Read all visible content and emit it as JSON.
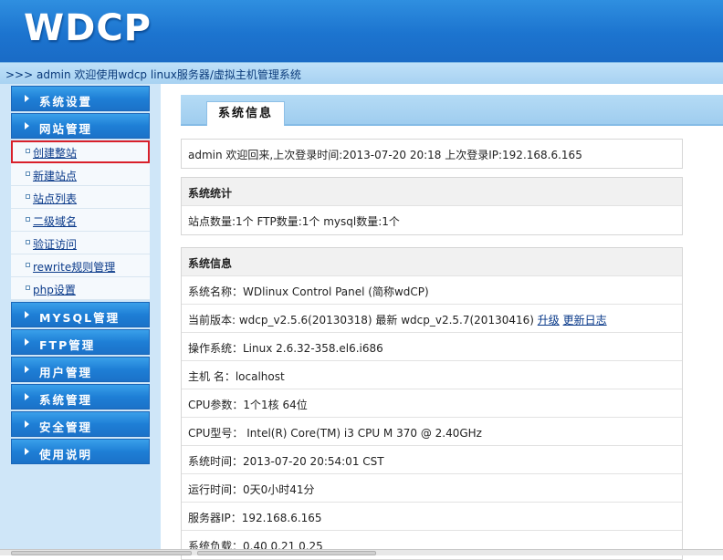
{
  "header": {
    "logo": "WDCP",
    "welcome": ">>> admin 欢迎使用wdcp linux服务器/虚拟主机管理系统"
  },
  "sidebar": {
    "sections": [
      {
        "label": "系统设置"
      },
      {
        "label": "网站管理"
      },
      {
        "label": "MYSQL管理"
      },
      {
        "label": "FTP管理"
      },
      {
        "label": "用户管理"
      },
      {
        "label": "系统管理"
      },
      {
        "label": "安全管理"
      },
      {
        "label": "使用说明"
      }
    ],
    "site_items": [
      {
        "label": "创建整站"
      },
      {
        "label": "新建站点"
      },
      {
        "label": "站点列表"
      },
      {
        "label": "二级域名"
      },
      {
        "label": "验证访问"
      },
      {
        "label": "rewrite规则管理"
      },
      {
        "label": "php设置"
      }
    ]
  },
  "main": {
    "tab": "系统信息",
    "login_info": "admin 欢迎回来,上次登录时间:2013-07-20 20:18 上次登录IP:192.168.6.165",
    "stats": {
      "title": "系统统计",
      "line": "站点数量:1个  FTP数量:1个  mysql数量:1个"
    },
    "info": {
      "title": "系统信息",
      "name": "系统名称：WDlinux Control Panel (简称wdCP)",
      "version": "当前版本: wdcp_v2.5.6(20130318) 最新 wdcp_v2.5.7(20130416)",
      "upgrade_link": "升级",
      "changelog_link": "更新日志",
      "os": "操作系统：Linux 2.6.32-358.el6.i686",
      "hostname": "主机 名：localhost",
      "cpu_params": "CPU参数：1个1核 64位",
      "cpu_model": "CPU型号： Intel(R) Core(TM) i3 CPU M 370 @ 2.40GHz",
      "system_time": "系统时间：2013-07-20 20:54:01 CST",
      "uptime": "运行时间：0天0小时41分",
      "server_ip": "服务器IP：192.168.6.165",
      "load": "系统负载：0.40   0.21   0.25"
    }
  }
}
